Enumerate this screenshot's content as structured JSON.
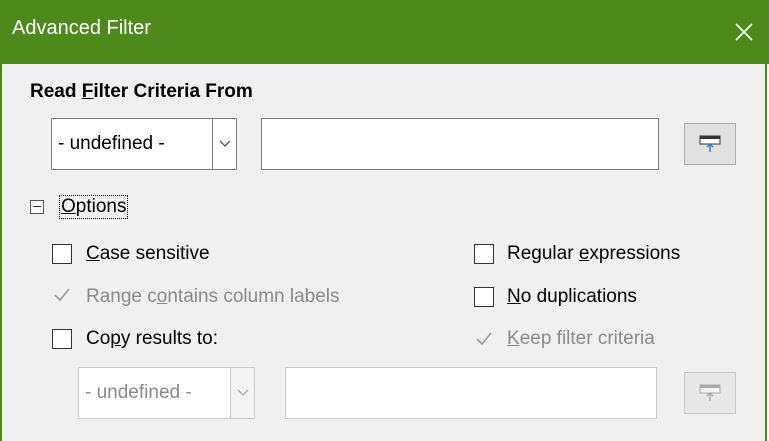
{
  "window": {
    "title": "Advanced Filter",
    "close_icon": "close-icon"
  },
  "read_criteria": {
    "heading_pre": "Read ",
    "heading_u": "F",
    "heading_post": "ilter Criteria From",
    "range_select_value": "- undefined -",
    "range_input_value": "",
    "shrink_button_icon": "shrink-icon"
  },
  "options": {
    "toggle_label_pre": "",
    "toggle_label_u": "O",
    "toggle_label_post": "ptions",
    "case_sensitive": {
      "pre": "",
      "u": "C",
      "post": "ase sensitive",
      "checked": false,
      "enabled": true
    },
    "range_labels": {
      "pre": "Range c",
      "u": "o",
      "post": "ntains column labels",
      "checked": true,
      "enabled": false
    },
    "copy_results": {
      "pre": "Co",
      "u": "p",
      "post": "y results to:",
      "checked": false,
      "enabled": true
    },
    "regex": {
      "pre": "Regular ",
      "u": "e",
      "post": "xpressions",
      "checked": false,
      "enabled": true
    },
    "no_dup": {
      "pre": "",
      "u": "N",
      "post": "o duplications",
      "checked": false,
      "enabled": true
    },
    "keep_criteria": {
      "pre": "",
      "u": "K",
      "post": "eep filter criteria",
      "checked": true,
      "enabled": false
    },
    "copy_select_value": "- undefined -",
    "copy_input_value": ""
  },
  "colors": {
    "titlebar": "#4e8a1b",
    "dialog_bg": "#f0f0f0",
    "disabled_text": "#8a8a8a"
  }
}
